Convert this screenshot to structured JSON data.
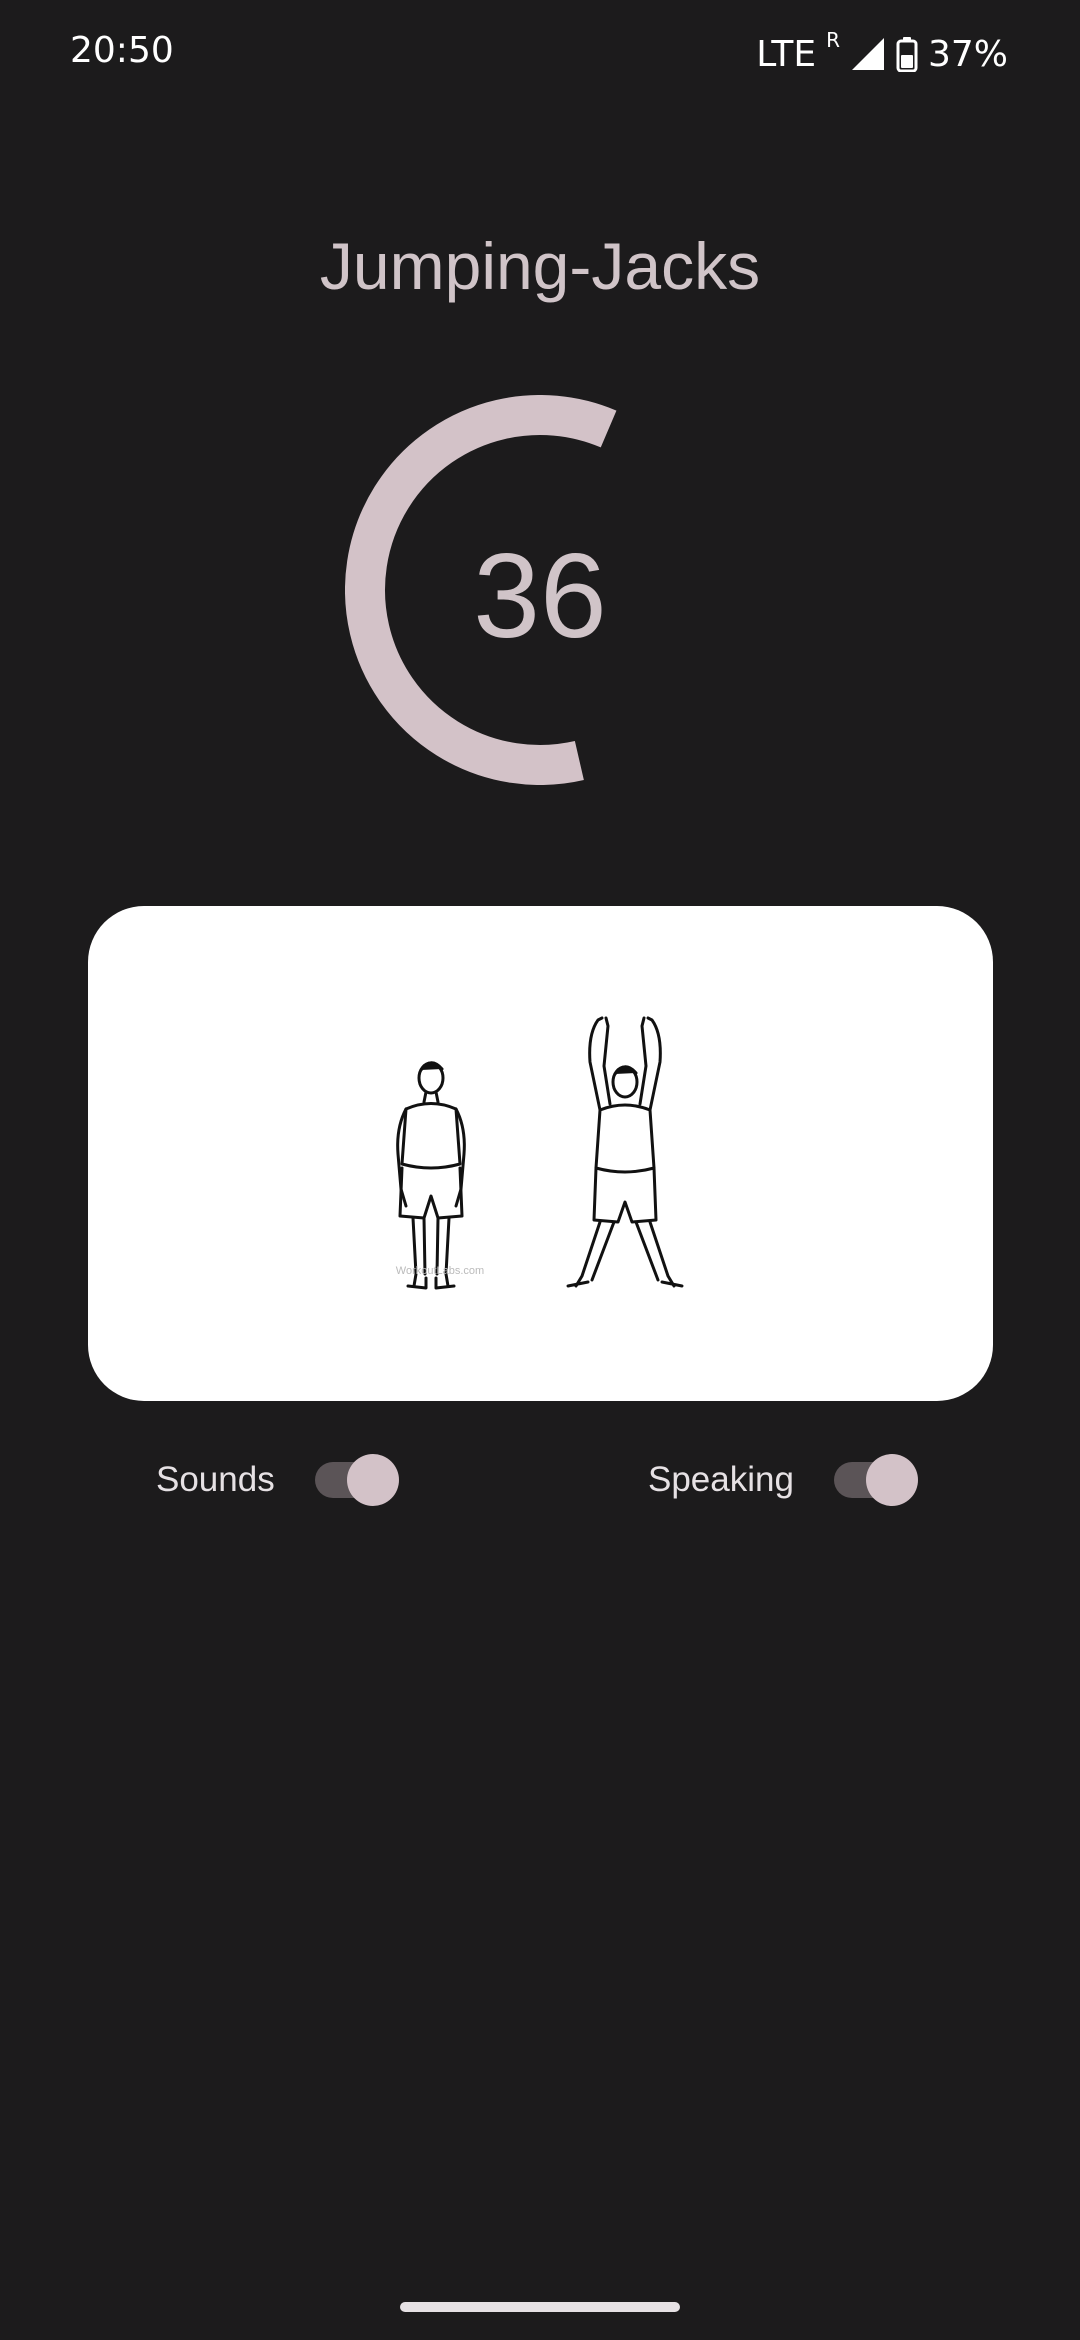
{
  "status_bar": {
    "time": "20:50",
    "network": "LTE",
    "roaming": "R",
    "battery": "37%",
    "icons": [
      "signal-icon",
      "battery-icon"
    ]
  },
  "exercise": {
    "title": "Jumping-Jacks",
    "countdown": "36",
    "illustration_watermark": "WorkoutLabs.com",
    "progress_fraction": 0.6
  },
  "toggles": {
    "sounds": {
      "label": "Sounds",
      "on": true
    },
    "speaking": {
      "label": "Speaking",
      "on": true
    }
  },
  "colors": {
    "background": "#1c1b1c",
    "accent": "#d3c2c8",
    "track": "#5b5457",
    "card": "#ffffff"
  }
}
